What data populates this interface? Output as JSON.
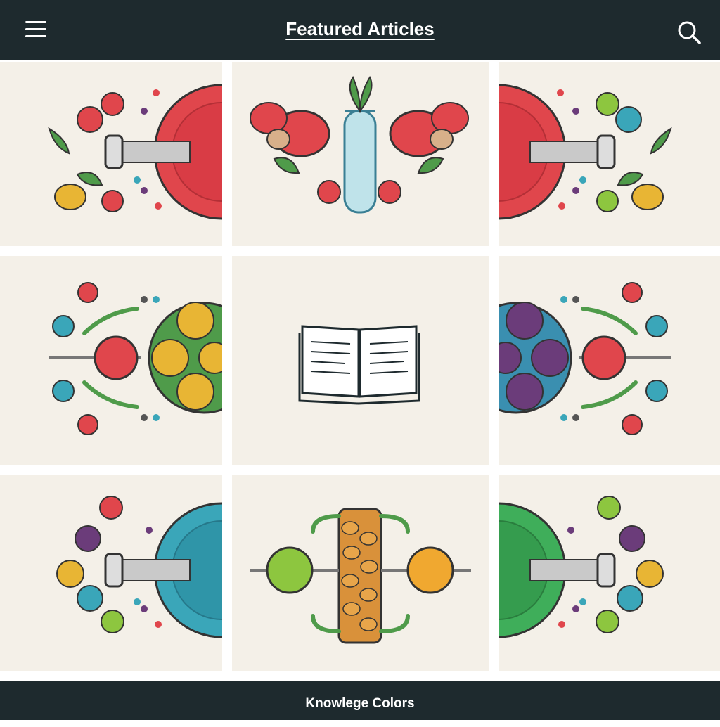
{
  "header": {
    "title": "Featured Articles",
    "menu_icon": "hamburger-menu-icon",
    "search_icon": "search-icon"
  },
  "tiles": [
    {
      "illustration": "flask-with-red-fruits-icon"
    },
    {
      "illustration": "test-tube-with-vegetables-icon"
    },
    {
      "illustration": "flask-with-red-fruits-mirrored-icon"
    },
    {
      "illustration": "molecule-with-yellow-cells-icon"
    },
    {
      "illustration": "open-book-icon"
    },
    {
      "illustration": "molecule-with-purple-cells-icon"
    },
    {
      "illustration": "flask-with-blue-liquid-icon"
    },
    {
      "illustration": "seed-column-with-spheres-icon"
    },
    {
      "illustration": "flask-with-green-liquid-icon"
    }
  ],
  "footer": {
    "text": "Knowlege Colors"
  },
  "colors": {
    "bar": "#1e2a2e",
    "tile": "#f4f0e8",
    "red": "#e0464c",
    "green": "#4f9b4a",
    "blue": "#3aa6b9",
    "yellow": "#e8b534",
    "purple": "#6b3c7a"
  }
}
